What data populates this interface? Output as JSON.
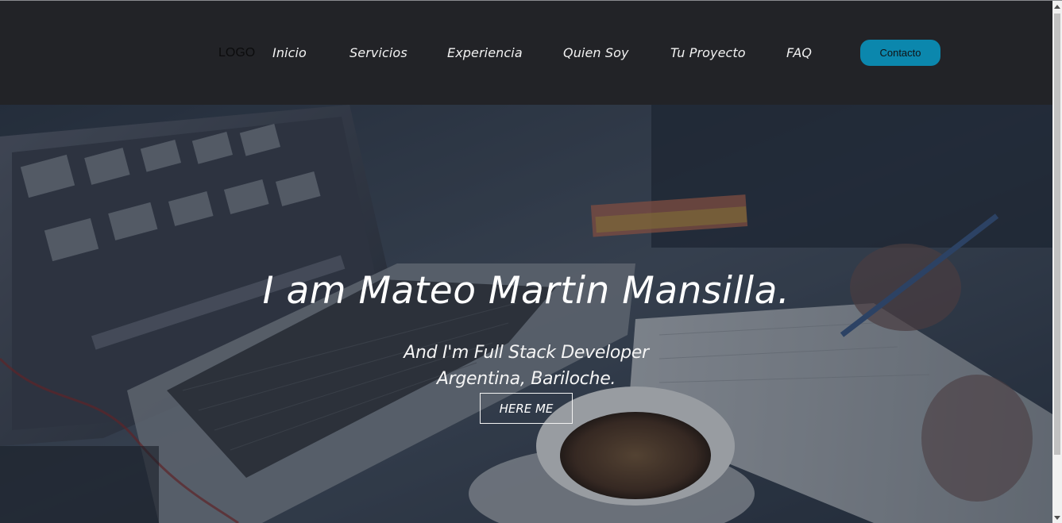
{
  "header": {
    "logo": "LOGO",
    "nav": [
      {
        "label": "Inicio"
      },
      {
        "label": "Servicios"
      },
      {
        "label": "Experiencia"
      },
      {
        "label": "Quien Soy"
      },
      {
        "label": "Tu Proyecto"
      },
      {
        "label": "FAQ"
      }
    ],
    "contact_label": "Contacto"
  },
  "hero": {
    "title": "I am Mateo Martin Mansilla.",
    "subtitle_line1": "And I'm Full Stack Developer",
    "subtitle_line2": "Argentina, Bariloche.",
    "button_label": "HERE ME",
    "background_image": "laptop-coffee-desk-photo"
  },
  "colors": {
    "header_bg": "#222327",
    "accent": "#0b87ad",
    "text_light": "#ffffff"
  }
}
